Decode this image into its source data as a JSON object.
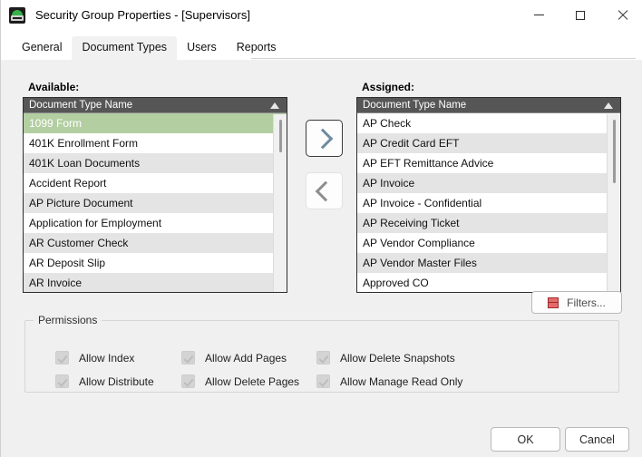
{
  "window": {
    "title": "Security Group Properties - [Supervisors]",
    "icon": "app-shield-icon",
    "controls": {
      "minimize": "—",
      "maximize": "□",
      "close": "✕"
    }
  },
  "tabs": [
    {
      "label": "General",
      "active": false
    },
    {
      "label": "Document Types",
      "active": true
    },
    {
      "label": "Users",
      "active": false
    },
    {
      "label": "Reports",
      "active": false
    }
  ],
  "available": {
    "label": "Available:",
    "column_header": "Document Type Name",
    "sort_indicator": "ascending",
    "rows": [
      {
        "name": "1099 Form",
        "selected": true
      },
      {
        "name": "401K Enrollment Form",
        "selected": false
      },
      {
        "name": "401K Loan Documents",
        "selected": false
      },
      {
        "name": "Accident Report",
        "selected": false
      },
      {
        "name": "AP Picture Document",
        "selected": false
      },
      {
        "name": "Application for Employment",
        "selected": false
      },
      {
        "name": "AR Customer Check",
        "selected": false
      },
      {
        "name": "AR Deposit Slip",
        "selected": false
      },
      {
        "name": "AR Invoice",
        "selected": false
      }
    ]
  },
  "assigned": {
    "label": "Assigned:",
    "column_header": "Document Type Name",
    "sort_indicator": "ascending",
    "rows": [
      {
        "name": "AP Check",
        "selected": false
      },
      {
        "name": "AP Credit Card EFT",
        "selected": false
      },
      {
        "name": "AP EFT Remittance Advice",
        "selected": false
      },
      {
        "name": "AP Invoice",
        "selected": false
      },
      {
        "name": "AP Invoice - Confidential",
        "selected": false
      },
      {
        "name": "AP Receiving Ticket",
        "selected": false
      },
      {
        "name": "AP Vendor Compliance",
        "selected": false
      },
      {
        "name": "AP Vendor Master Files",
        "selected": false
      },
      {
        "name": "Approved CO",
        "selected": false
      }
    ]
  },
  "transfer": {
    "assign_icon": "chevron-right-icon",
    "unassign_icon": "chevron-left-icon"
  },
  "filters": {
    "label": "Filters...",
    "icon": "filter-block-icon"
  },
  "permissions": {
    "legend": "Permissions",
    "items": [
      {
        "label": "Allow Index",
        "checked": true,
        "enabled": false
      },
      {
        "label": "Allow Distribute",
        "checked": true,
        "enabled": false
      },
      {
        "label": "Allow Add Pages",
        "checked": true,
        "enabled": false
      },
      {
        "label": "Allow Delete Pages",
        "checked": true,
        "enabled": false
      },
      {
        "label": "Allow Delete Snapshots",
        "checked": true,
        "enabled": false
      },
      {
        "label": "Allow Manage Read Only",
        "checked": true,
        "enabled": false
      }
    ]
  },
  "footer": {
    "ok": "OK",
    "cancel": "Cancel"
  },
  "colors": {
    "selection_green": "#b3cfa2",
    "grid_header": "#565656",
    "alt_row": "#e4e4e4",
    "accent_chevron": "#6e8c9e",
    "filter_red": "#e46b6b"
  }
}
